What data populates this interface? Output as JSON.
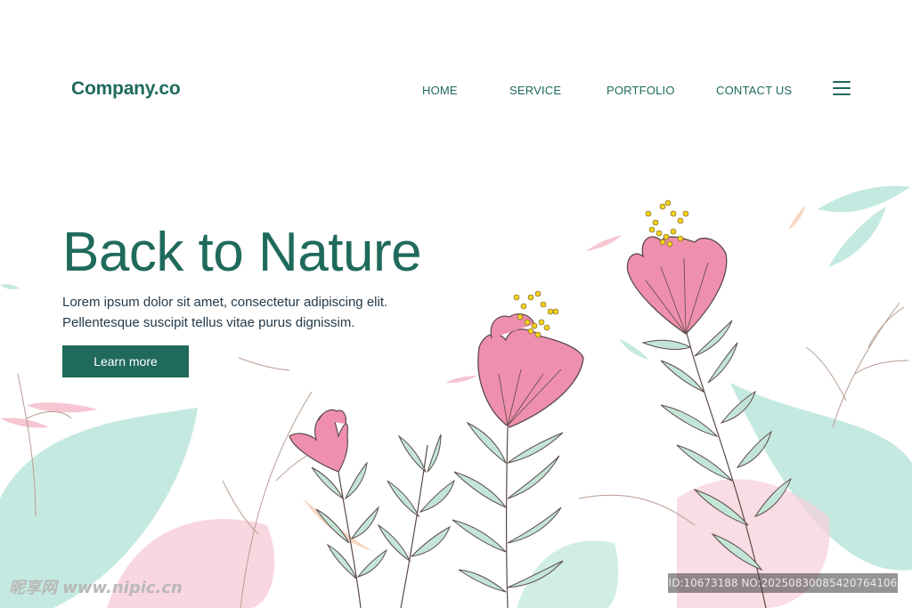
{
  "header": {
    "brand": "Company.co",
    "nav": [
      {
        "label": "HOME"
      },
      {
        "label": "SERVICE"
      },
      {
        "label": "PORTFOLIO"
      },
      {
        "label": "CONTACT US"
      }
    ],
    "menu_icon": "hamburger-menu-icon"
  },
  "hero": {
    "title": "Back to Nature",
    "subtitle_line1": "Lorem ipsum dolor sit amet, consectetur adipiscing elit.",
    "subtitle_line2": "Pellentesque suscipit tellus vitae purus dignissim.",
    "cta_label": "Learn more"
  },
  "overlay": {
    "watermark": "昵享网 www.nipic.cn",
    "image_id": "ID:10673188 NO:20250830085420764106"
  },
  "colors": {
    "primary": "#1f6a5c",
    "text": "#243a4a",
    "flower_pink": "#ef8fae",
    "leaf_mint": "#bfe7de",
    "leaf_pink": "#f6c6d2",
    "stamen_yellow": "#f4d21c"
  }
}
